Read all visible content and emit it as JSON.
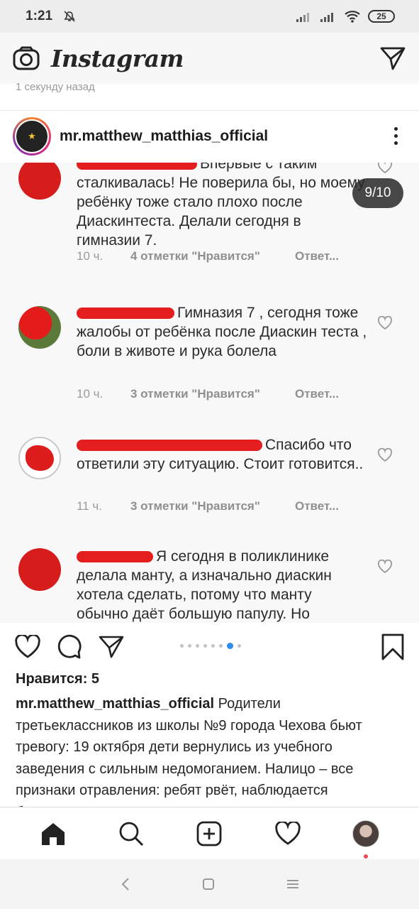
{
  "status_bar": {
    "time": "1:21",
    "battery": "25"
  },
  "header": {
    "app_name": "Instagram"
  },
  "timestamp": "1 секунду назад",
  "post": {
    "username": "mr.matthew_matthias_official",
    "slide_counter": "9/10"
  },
  "comments": [
    {
      "text": "Впервые с таким сталкивалась! Не поверила бы, но моему ребёнку тоже стало плохо после Диаскинтеста. Делали сегодня в гимназии 7.",
      "time": "10 ч.",
      "likes": "4 отметки \"Нравится\"",
      "reply": "Ответ..."
    },
    {
      "text": "Гимназия 7 , сегодня тоже жалобы от ребёнка после Диаскин теста , боли в животе и рука болела",
      "time": "10 ч.",
      "likes": "3 отметки \"Нравится\"",
      "reply": "Ответ..."
    },
    {
      "text": "Спасибо что ответили эту ситуацию.  Стоит готовится..",
      "time": "11 ч.",
      "likes": "3 отметки \"Нравится\"",
      "reply": "Ответ..."
    },
    {
      "text": "Я сегодня в поликлинике делала манту, а изначально диаскин хотела сделать, потому что манту обычно даёт большую папулу. Но"
    }
  ],
  "likes_label": "Нравится: 5",
  "caption": {
    "username": "mr.matthew_matthias_official",
    "text": "Родители третьеклассников из школы №9 города Чехова бьют тревогу: 19 октября дети вернулись из учебного заведения с сильным недомоганием. Налицо – все признаки отравления: ребят рвёт, наблюдается бледность, вялость, кружится голова"
  },
  "carousel": {
    "total": 8,
    "active_index": 6
  },
  "colors": {
    "accent": "#2d8cf0",
    "redaction": "#e41e1e",
    "notification": "#ed4956"
  },
  "icons": [
    "camera-icon",
    "direct-message-icon",
    "heart-icon",
    "comment-icon",
    "share-icon",
    "bookmark-icon",
    "home-icon",
    "search-icon",
    "new-post-icon",
    "activity-icon"
  ]
}
